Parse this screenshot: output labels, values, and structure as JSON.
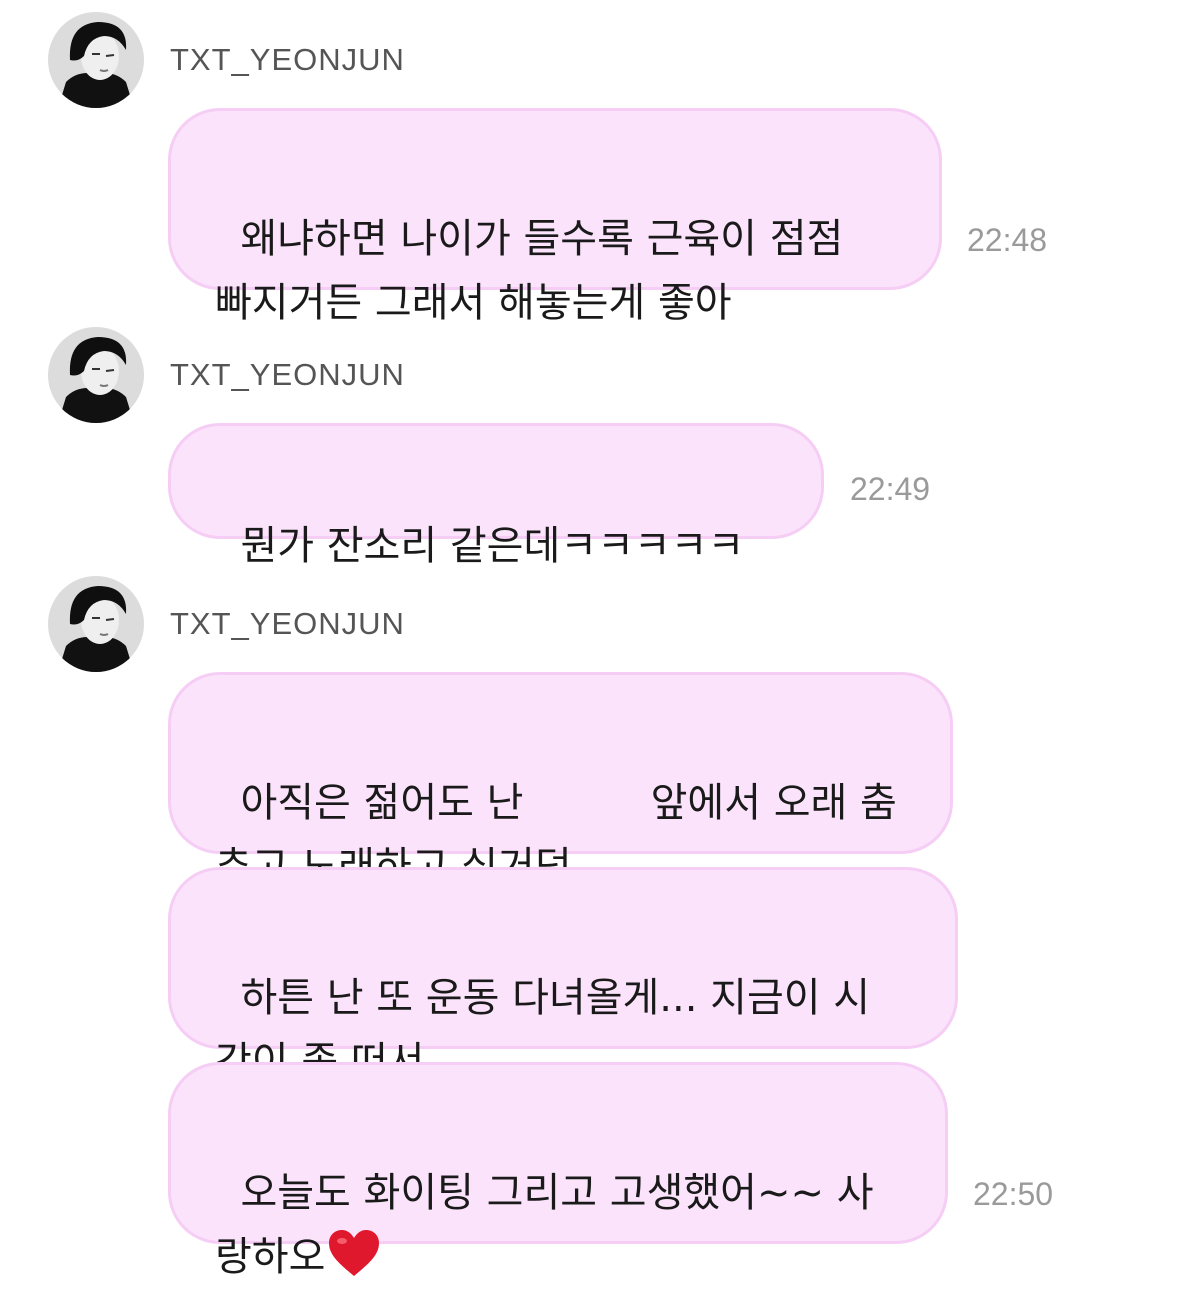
{
  "sender_name": "TXT_YEONJUN",
  "groups": [
    {
      "sender": "TXT_YEONJUN",
      "messages": [
        {
          "text": "왜냐하면 나이가 들수록 근육이 점점\n빠지거든 그래서 해놓는게 좋아",
          "time": "22:48"
        }
      ]
    },
    {
      "sender": "TXT_YEONJUN",
      "messages": [
        {
          "text": "뭔가 잔소리 같은데ㅋㅋㅋㅋㅋ",
          "time": "22:49"
        }
      ]
    },
    {
      "sender": "TXT_YEONJUN",
      "messages": [
        {
          "text": "아직은 젊어도 난          앞에서 오래 춤\n추고 노래하고 싶거덩",
          "time": ""
        },
        {
          "text": "하튼 난 또 운동 다녀올게... 지금이 시\n간이 좀 떠서",
          "time": ""
        },
        {
          "text": "오늘도 화이팅 그리고 고생했어~~ 사\n랑하오",
          "emoji": "heart-icon",
          "time": "22:50"
        }
      ]
    }
  ],
  "colors": {
    "bubble_background": "#fbe4fb",
    "bubble_border": "#f5cdf5",
    "message_text": "#1a1a1a",
    "sender_text": "#555555",
    "timestamp_text": "#9a9a9a",
    "heart": "#e0182d"
  }
}
